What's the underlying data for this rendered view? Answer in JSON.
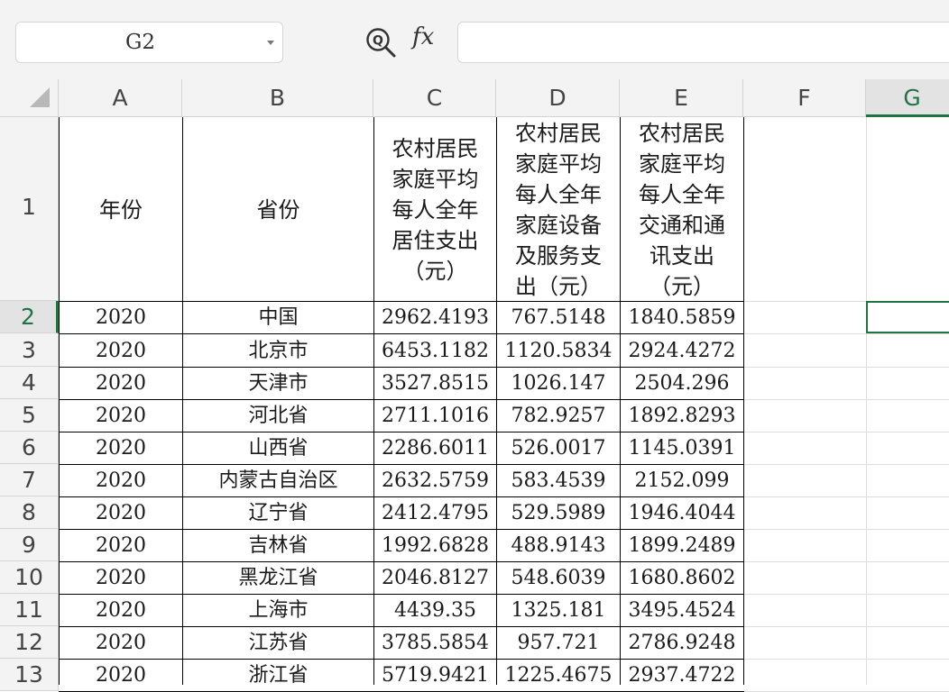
{
  "formula_bar": {
    "name_box": "G2",
    "zoom_icon": "find-zoom-icon",
    "fx_label": "fx",
    "formula": ""
  },
  "columns": [
    "A",
    "B",
    "C",
    "D",
    "E",
    "F",
    "G"
  ],
  "selected_cell": "G2",
  "header_row": {
    "A": "年份",
    "B": "省份",
    "C": "农村居民\n家庭平均\n每人全年\n居住支出\n（元）",
    "D": "农村居民\n家庭平均\n每人全年\n家庭设备\n及服务支\n出（元）",
    "E": "农村居民\n家庭平均\n每人全年\n交通和通\n讯支出\n（元）"
  },
  "rows": [
    {
      "row": "1"
    },
    {
      "row": "2",
      "A": "2020",
      "B": "中国",
      "C": "2962.4193",
      "D": "767.5148",
      "E": "1840.5859"
    },
    {
      "row": "3",
      "A": "2020",
      "B": "北京市",
      "C": "6453.1182",
      "D": "1120.5834",
      "E": "2924.4272"
    },
    {
      "row": "4",
      "A": "2020",
      "B": "天津市",
      "C": "3527.8515",
      "D": "1026.147",
      "E": "2504.296"
    },
    {
      "row": "5",
      "A": "2020",
      "B": "河北省",
      "C": "2711.1016",
      "D": "782.9257",
      "E": "1892.8293"
    },
    {
      "row": "6",
      "A": "2020",
      "B": "山西省",
      "C": "2286.6011",
      "D": "526.0017",
      "E": "1145.0391"
    },
    {
      "row": "7",
      "A": "2020",
      "B": "内蒙古自治区",
      "C": "2632.5759",
      "D": "583.4539",
      "E": "2152.099"
    },
    {
      "row": "8",
      "A": "2020",
      "B": "辽宁省",
      "C": "2412.4795",
      "D": "529.5989",
      "E": "1946.4044"
    },
    {
      "row": "9",
      "A": "2020",
      "B": "吉林省",
      "C": "1992.6828",
      "D": "488.9143",
      "E": "1899.2489"
    },
    {
      "row": "10",
      "A": "2020",
      "B": "黑龙江省",
      "C": "2046.8127",
      "D": "548.6039",
      "E": "1680.8602"
    },
    {
      "row": "11",
      "A": "2020",
      "B": "上海市",
      "C": "4439.35",
      "D": "1325.181",
      "E": "3495.4524"
    },
    {
      "row": "12",
      "A": "2020",
      "B": "江苏省",
      "C": "3785.5854",
      "D": "957.721",
      "E": "2786.9248"
    },
    {
      "row": "13",
      "A": "2020",
      "B": "浙江省",
      "C": "5719.9421",
      "D": "1225.4675",
      "E": "2937.4722"
    }
  ],
  "colors": {
    "selection_accent": "#217346",
    "header_bg": "#f3f3f3",
    "gridline": "#d4d4d4",
    "table_border": "#000000"
  }
}
